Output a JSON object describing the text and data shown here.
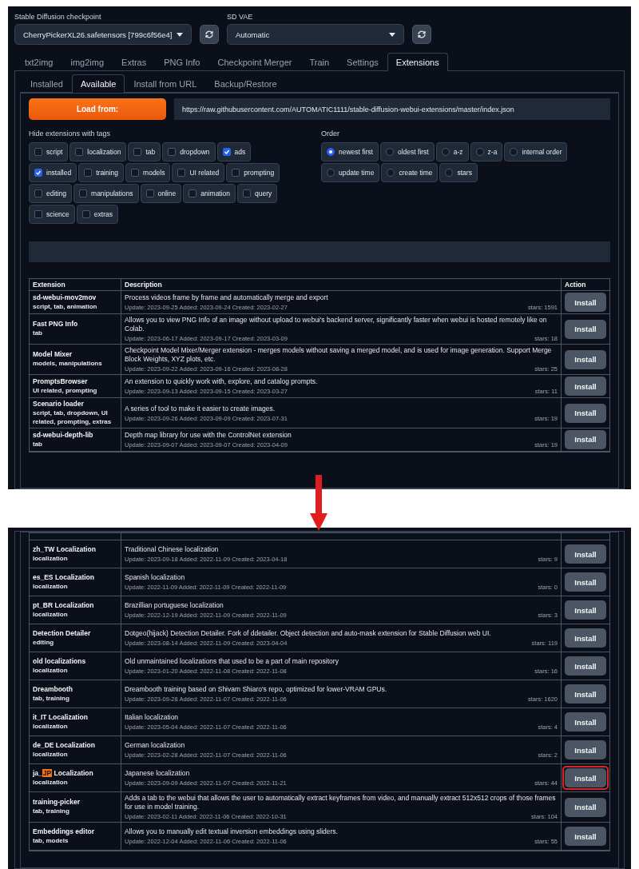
{
  "top": {
    "settings": [
      {
        "label": "Stable Diffusion checkpoint",
        "value": "CherryPickerXL26.safetensors [799c6f56e4]"
      },
      {
        "label": "SD VAE",
        "value": "Automatic"
      }
    ],
    "tabs": [
      {
        "label": "txt2img",
        "selected": false
      },
      {
        "label": "img2img",
        "selected": false
      },
      {
        "label": "Extras",
        "selected": false
      },
      {
        "label": "PNG Info",
        "selected": false
      },
      {
        "label": "Checkpoint Merger",
        "selected": false
      },
      {
        "label": "Train",
        "selected": false
      },
      {
        "label": "Settings",
        "selected": false
      },
      {
        "label": "Extensions",
        "selected": true
      }
    ],
    "subtabs": [
      {
        "label": "Installed",
        "selected": false
      },
      {
        "label": "Available",
        "selected": true
      },
      {
        "label": "Install from URL",
        "selected": false
      },
      {
        "label": "Backup/Restore",
        "selected": false
      }
    ],
    "load_button": "Load from:",
    "url": "https://raw.githubusercontent.com/AUTOMATIC1111/stable-diffusion-webui-extensions/master/index.json",
    "hide_tags": {
      "label": "Hide extensions with tags",
      "tags": [
        {
          "label": "script",
          "checked": false
        },
        {
          "label": "localization",
          "checked": false
        },
        {
          "label": "tab",
          "checked": false
        },
        {
          "label": "dropdown",
          "checked": false
        },
        {
          "label": "ads",
          "checked": true
        },
        {
          "label": "installed",
          "checked": true
        },
        {
          "label": "training",
          "checked": false
        },
        {
          "label": "models",
          "checked": false
        },
        {
          "label": "UI related",
          "checked": false
        },
        {
          "label": "prompting",
          "checked": false
        },
        {
          "label": "editing",
          "checked": false
        },
        {
          "label": "manipulations",
          "checked": false
        },
        {
          "label": "online",
          "checked": false
        },
        {
          "label": "animation",
          "checked": false
        },
        {
          "label": "query",
          "checked": false
        },
        {
          "label": "science",
          "checked": false
        },
        {
          "label": "extras",
          "checked": false
        }
      ]
    },
    "order": {
      "label": "Order",
      "options": [
        {
          "label": "newest first",
          "selected": true
        },
        {
          "label": "oldest first",
          "selected": false
        },
        {
          "label": "a-z",
          "selected": false
        },
        {
          "label": "z-a",
          "selected": false
        },
        {
          "label": "internal order",
          "selected": false
        },
        {
          "label": "update time",
          "selected": false
        },
        {
          "label": "create time",
          "selected": false
        },
        {
          "label": "stars",
          "selected": false
        }
      ]
    },
    "table": {
      "columns": [
        "Extension",
        "Description",
        "Action"
      ],
      "rows": [
        {
          "name": "sd-webui-mov2mov",
          "tags": "script, tab, animation",
          "description": "Process videos frame by frame and automatically merge and export",
          "dates": "Update: 2023-09-25 Added: 2023-09-24 Created: 2023-02-27",
          "stars": "stars: 1591",
          "action": "Install"
        },
        {
          "name": "Fast PNG Info",
          "tags": "tab",
          "description": "Allows you to view PNG Info of an image without upload to webui's backend server, significantly faster when webui is hosted remotely like on Colab.",
          "dates": "Update: 2023-06-17 Added: 2023-09-17 Created: 2023-03-09",
          "stars": "stars: 18",
          "action": "Install"
        },
        {
          "name": "Model Mixer",
          "tags": "models, manipulations",
          "description": "Checkpoint Model Mixer/Merger extension - merges models without saving a merged model, and is used for image generation. Support Merge Block Weights, XYZ plots, etc.",
          "dates": "Update: 2023-09-22 Added: 2023-09-16 Created: 2023-08-28",
          "stars": "stars: 25",
          "action": "Install"
        },
        {
          "name": "PromptsBrowser",
          "tags": "UI related, prompting",
          "description": "An extension to quickly work with, explore, and catalog prompts.",
          "dates": "Update: 2023-09-13 Added: 2023-09-15 Created: 2023-03-27",
          "stars": "stars: 11",
          "action": "Install"
        },
        {
          "name": "Scenario loader",
          "tags": "script, tab, dropdown, UI related, prompting, extras",
          "description": "A series of tool to make it easier to create images.",
          "dates": "Update: 2023-09-26 Added: 2023-09-09 Created: 2023-07-31",
          "stars": "stars: 19",
          "action": "Install"
        },
        {
          "name": "sd-webui-depth-lib",
          "tags": "tab",
          "description": "Depth map library for use with the ControlNet extension",
          "dates": "Update: 2023-09-07 Added: 2023-09-07 Created: 2023-04-09",
          "stars": "stars: 19",
          "action": "Install"
        }
      ]
    }
  },
  "bottom": {
    "rows": [
      {
        "name_parts": [
          {
            "text": "zh_TW Localization",
            "highlighted": false
          }
        ],
        "tags": "localization",
        "description": "Traditional Chinese localization",
        "dates": "Update: 2023-09-18 Added: 2022-11-09 Created: 2023-04-18",
        "stars": "stars: 9",
        "action": "Install",
        "outlined": false
      },
      {
        "name_parts": [
          {
            "text": "es_ES Localization",
            "highlighted": false
          }
        ],
        "tags": "localization",
        "description": "Spanish localization",
        "dates": "Update: 2022-11-09 Added: 2022-11-09 Created: 2022-11-09",
        "stars": "stars: 0",
        "action": "Install",
        "outlined": false
      },
      {
        "name_parts": [
          {
            "text": "pt_BR Localization",
            "highlighted": false
          }
        ],
        "tags": "localization",
        "description": "Brazillian portuguese localization",
        "dates": "Update: 2022-12-19 Added: 2022-11-09 Created: 2022-11-09",
        "stars": "stars: 3",
        "action": "Install",
        "outlined": false
      },
      {
        "name_parts": [
          {
            "text": "Detection Detailer",
            "highlighted": false
          }
        ],
        "tags": "editing",
        "description": "Dotgeo(hijack) Detection Detailer. Fork of ddetailer. Object detection and auto-mask extension for Stable Diffusion web UI.",
        "dates": "Update: 2023-08-14 Added: 2022-11-09 Created: 2023-04-04",
        "stars": "stars: 119",
        "action": "Install",
        "outlined": false
      },
      {
        "name_parts": [
          {
            "text": "old localizations",
            "highlighted": false
          }
        ],
        "tags": "localization",
        "description": "Old unmaintained localizations that used to be a part of main repository",
        "dates": "Update: 2023-01-20 Added: 2022-11-08 Created: 2022-11-08",
        "stars": "stars: 16",
        "action": "Install",
        "outlined": false
      },
      {
        "name_parts": [
          {
            "text": "Dreambooth",
            "highlighted": false
          }
        ],
        "tags": "tab, training",
        "description": "Dreambooth training based on Shivam Shiaro's repo, optimized for lower-VRAM GPUs.",
        "dates": "Update: 2023-09-28 Added: 2022-11-07 Created: 2022-11-06",
        "stars": "stars: 1620",
        "action": "Install",
        "outlined": false
      },
      {
        "name_parts": [
          {
            "text": "it_IT Localization",
            "highlighted": false
          }
        ],
        "tags": "localization",
        "description": "Italian localization",
        "dates": "Update: 2023-05-04 Added: 2022-11-07 Created: 2022-11-06",
        "stars": "stars: 4",
        "action": "Install",
        "outlined": false
      },
      {
        "name_parts": [
          {
            "text": "de_DE Localization",
            "highlighted": false
          }
        ],
        "tags": "localization",
        "description": "German localization",
        "dates": "Update: 2023-02-28 Added: 2022-11-07 Created: 2022-11-06",
        "stars": "stars: 2",
        "action": "Install",
        "outlined": false
      },
      {
        "name_parts": [
          {
            "text": "ja_",
            "highlighted": false
          },
          {
            "text": "JP",
            "highlighted": true
          },
          {
            "text": " Localization",
            "highlighted": false
          }
        ],
        "tags": "localization",
        "description": "Japanese localization",
        "dates": "Update: 2023-09-09 Added: 2022-11-07 Created: 2022-11-21",
        "stars": "stars: 44",
        "action": "Install",
        "outlined": true
      },
      {
        "name_parts": [
          {
            "text": "training-picker",
            "highlighted": false
          }
        ],
        "tags": "tab, training",
        "description": "Adds a tab to the webui that allows the user to automatically extract keyframes from video, and manually extract 512x512 crops of those frames for use in model training.",
        "dates": "Update: 2023-02-11 Added: 2022-11-06 Created: 2022-10-31",
        "stars": "stars: 104",
        "action": "Install",
        "outlined": false
      },
      {
        "name_parts": [
          {
            "text": "Embeddings editor",
            "highlighted": false
          }
        ],
        "tags": "tab, models",
        "description": "Allows you to manually edit textual inversion embeddings using sliders.",
        "dates": "Update: 2022-12-04 Added: 2022-11-06 Created: 2022-11-06",
        "stars": "stars: 55",
        "action": "Install",
        "outlined": false
      }
    ]
  }
}
